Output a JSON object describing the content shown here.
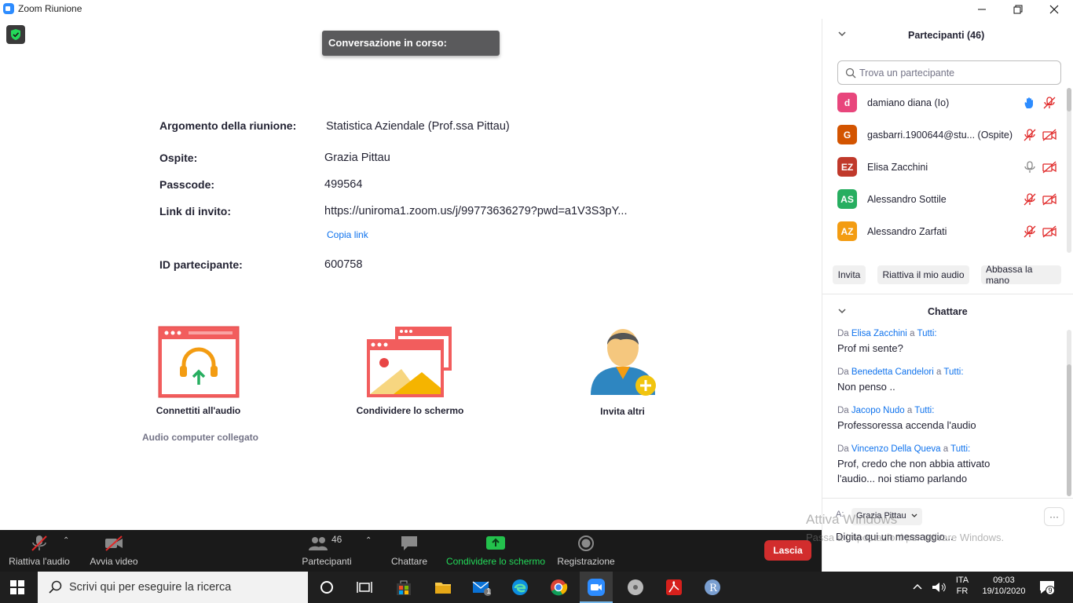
{
  "window": {
    "title": "Zoom Riunione"
  },
  "tooltip": {
    "text": "Conversazione in corso:"
  },
  "meeting_info": {
    "topic_label": "Argomento della riunione:",
    "topic_value": "Statistica Aziendale  (Prof.ssa Pittau)",
    "host_label": "Ospite:",
    "host_value": "Grazia Pittau",
    "passcode_label": "Passcode:",
    "passcode_value": "499564",
    "invite_label": "Link di invito:",
    "invite_value": "https://uniroma1.zoom.us/j/99773636279?pwd=a1V3S3pY...",
    "copy_link": "Copia link",
    "participant_id_label": "ID partecipante:",
    "participant_id_value": "600758"
  },
  "actions": {
    "audio": "Connettiti all'audio",
    "audio_status": "Audio computer collegato",
    "share": "Condividere lo schermo",
    "invite": "Invita altri"
  },
  "toolbar": {
    "unmute": "Riattiva l'audio",
    "video": "Avvia video",
    "participants": "Partecipanti",
    "participants_count": "46",
    "chat": "Chattare",
    "share": "Condividere lo schermo",
    "record": "Registrazione",
    "leave": "Lascia"
  },
  "participants_panel": {
    "title": "Partecipanti (46)",
    "search_placeholder": "Trova un partecipante",
    "list": [
      {
        "initials": "d",
        "name": "damiano diana (Io)",
        "color": "#e8467c"
      },
      {
        "initials": "G",
        "name": "gasbarri.1900644@stu...  (Ospite)",
        "color": "#d35400"
      },
      {
        "initials": "EZ",
        "name": "Elisa Zacchini",
        "color": "#c0392b"
      },
      {
        "initials": "AS",
        "name": "Alessandro Sottile",
        "color": "#27ae60"
      },
      {
        "initials": "AZ",
        "name": "Alessandro Zarfati",
        "color": "#f39c12"
      }
    ],
    "buttons": {
      "invite": "Invita",
      "unmute_me": "Riattiva il mio audio",
      "lower_hand": "Abbassa la mano"
    }
  },
  "chat_panel": {
    "title": "Chattare",
    "from_word": "Da",
    "to_word": "a",
    "messages": [
      {
        "from": "Elisa Zacchini",
        "to": "Tutti:",
        "text": "Prof mi sente?"
      },
      {
        "from": "Benedetta Candelori",
        "to": "Tutti:",
        "text": "Non penso .."
      },
      {
        "from": "Jacopo Nudo",
        "to": "Tutti:",
        "text": "Professoressa accenda l'audio"
      },
      {
        "from": "Vincenzo Della Queva",
        "to": "Tutti:",
        "text": "Prof, credo che non abbia attivato l'audio... noi stiamo parlando"
      }
    ],
    "to_label": "A:",
    "recipient": "Grazia Pittau",
    "more": "···",
    "input_placeholder": "Digita qui un messaggio..."
  },
  "watermark": {
    "line1": "Attiva Windows",
    "line2": "Passa a Impostazioni per attivare Windows."
  },
  "taskbar": {
    "search_placeholder": "Scrivi qui per eseguire la ricerca",
    "lang_top": "ITA",
    "lang_bottom": "FR",
    "time": "09:03",
    "date": "19/10/2020",
    "notif_count": "9",
    "mail_badge": "1"
  }
}
